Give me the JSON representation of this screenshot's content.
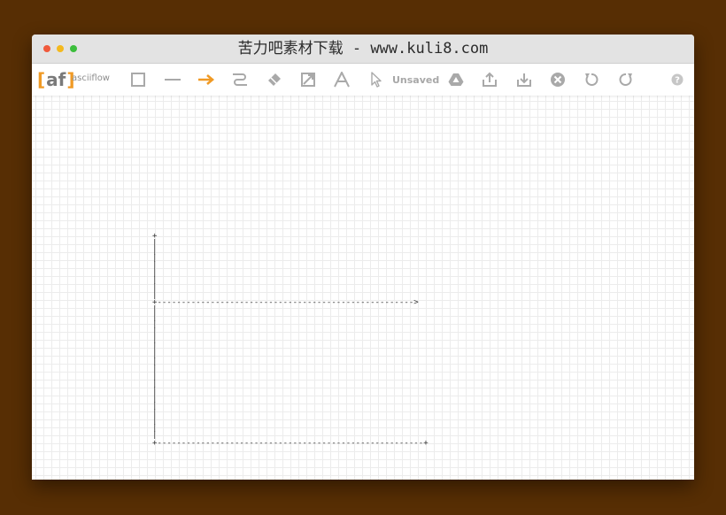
{
  "window": {
    "title": "苦力吧素材下载 - www.kuli8.com"
  },
  "traffic_lights": {
    "close_color": "#f05a3c",
    "minimize_color": "#f4b91e",
    "maximize_color": "#3cbe3c"
  },
  "toolbar": {
    "logo_open": "[",
    "logo_text": "af",
    "logo_close": "]",
    "app_name": "asciiflow",
    "status": "Unsaved",
    "tools": [
      {
        "name": "box-tool",
        "icon": "square-icon"
      },
      {
        "name": "line-tool",
        "icon": "line-icon"
      },
      {
        "name": "arrow-tool",
        "icon": "arrow-right-icon",
        "active": true
      },
      {
        "name": "freeform-tool",
        "icon": "curve-icon"
      },
      {
        "name": "erase-tool",
        "icon": "eraser-icon"
      },
      {
        "name": "resize-tool",
        "icon": "resize-box-icon"
      },
      {
        "name": "text-tool",
        "icon": "letter-a-icon"
      },
      {
        "name": "select-tool",
        "icon": "cursor-icon"
      }
    ],
    "actions": [
      {
        "name": "drive-button",
        "icon": "drive-icon"
      },
      {
        "name": "export-button",
        "icon": "upload-icon"
      },
      {
        "name": "import-button",
        "icon": "download-icon"
      },
      {
        "name": "clear-button",
        "icon": "close-circle-icon"
      },
      {
        "name": "undo-button",
        "icon": "undo-icon"
      },
      {
        "name": "redo-button",
        "icon": "redo-icon"
      },
      {
        "name": "help-button",
        "icon": "help-icon"
      }
    ],
    "accent_color": "#f09a25",
    "icon_color": "#a9a9a9"
  },
  "canvas": {
    "ascii": "+\n|\n|\n|\n|\n|\n|\n|\n|\n+----------------------------------------------------->\n|\n|\n|\n|\n|\n|\n|\n|\n|\n|\n|\n|\n|\n|\n|\n|\n|\n|\n+-------------------------------------------------------+"
  }
}
